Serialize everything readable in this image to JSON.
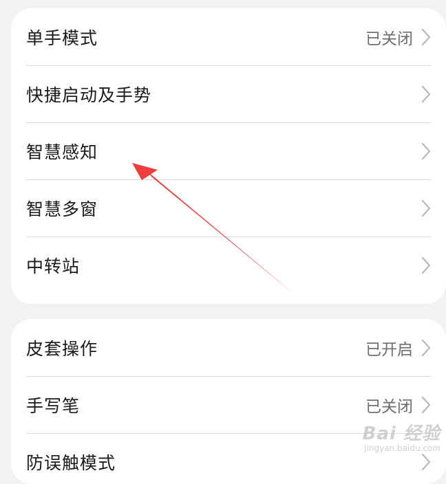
{
  "settings_group_1": [
    {
      "label": "单手模式",
      "value": "已关闭"
    },
    {
      "label": "快捷启动及手势",
      "value": ""
    },
    {
      "label": "智慧感知",
      "value": ""
    },
    {
      "label": "智慧多窗",
      "value": ""
    },
    {
      "label": "中转站",
      "value": ""
    }
  ],
  "settings_group_2": [
    {
      "label": "皮套操作",
      "value": "已开启"
    },
    {
      "label": "手写笔",
      "value": "已关闭"
    },
    {
      "label": "防误触模式",
      "value": ""
    }
  ],
  "annotation": {
    "type": "red-arrow",
    "color": "#ee3e3e",
    "points_to": "智慧感知"
  },
  "watermark": {
    "main": "Bai 经验",
    "sub": "jingyan.baidu.com"
  },
  "colors": {
    "background": "#f1f2f4",
    "card": "#ffffff",
    "divider": "#dcdcdc",
    "secondary_text": "#6e6e6e",
    "chevron": "#b8b8b8"
  }
}
